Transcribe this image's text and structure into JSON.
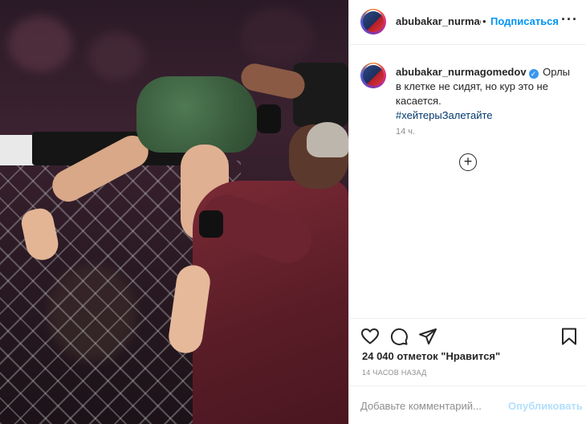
{
  "post": {
    "username": "abubakar_nurmagomedov",
    "header_username": "abubakar_nurmagc",
    "separator": "•",
    "follow_label": "Подписаться",
    "more_label": "···",
    "avatar_icon": "profile-avatar-icon",
    "verified_icon": "verified-badge-icon",
    "caption_text": "Орлы в клетке не сидят, но кур это не касается.",
    "hashtag": "#хейтерыЗалетайте",
    "caption_time": "14 ч.",
    "load_more_icon": "plus-circle-icon",
    "likes_text": "24 040 отметок \"Нравится\"",
    "timestamp": "14 часов назад",
    "comment_placeholder": "Добавьте комментарий...",
    "publish_label": "Опубликовать"
  },
  "actions": {
    "icons": [
      "heart-icon",
      "comment-icon",
      "share-icon",
      "bookmark-icon"
    ]
  },
  "colors": {
    "accent": "#0095f6",
    "link": "#00376b",
    "muted": "#8e8e8e",
    "publish_disabled": "#b2dffc"
  }
}
